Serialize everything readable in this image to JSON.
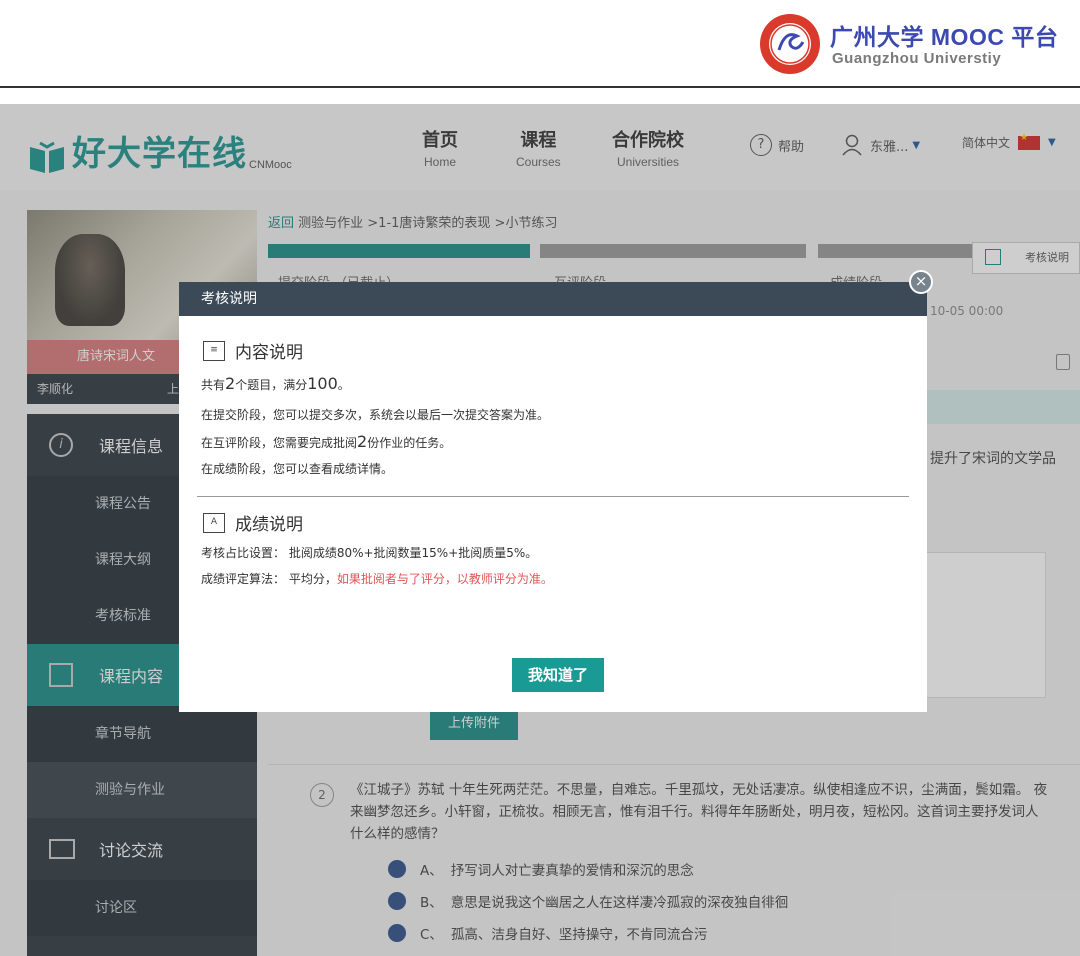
{
  "doc_header": {
    "logo_name": "广州大学 MOOC 平台",
    "logo_sub": "Guangzhou Universtiy"
  },
  "site": {
    "brand": "好大学在线",
    "brand_sub": "CNMooc",
    "nav": [
      {
        "zh": "首页",
        "en": "Home"
      },
      {
        "zh": "课程",
        "en": "Courses"
      },
      {
        "zh": "合作院校",
        "en": "Universities"
      }
    ],
    "help": "帮助",
    "user": "东雅...",
    "lang": "简体中文"
  },
  "sidebar": {
    "course_title": "唐诗宋词人文",
    "teacher": "李顺化",
    "teacher_extra": "上",
    "menu": [
      {
        "label": "课程信息",
        "type": "head"
      },
      {
        "label": "课程公告",
        "type": "sub"
      },
      {
        "label": "课程大纲",
        "type": "sub"
      },
      {
        "label": "考核标准",
        "type": "sub"
      },
      {
        "label": "课程内容",
        "type": "head"
      },
      {
        "label": "章节导航",
        "type": "sub"
      },
      {
        "label": "测验与作业",
        "type": "sub"
      },
      {
        "label": "讨论交流",
        "type": "head"
      },
      {
        "label": "讨论区",
        "type": "sub"
      }
    ]
  },
  "main": {
    "back": "返回",
    "breadcrumb": "测验与作业 >1-1唐诗繁荣的表现 >小节练习",
    "steps": [
      "提交阶段 （已截止）",
      "互评阶段",
      "成绩阶段"
    ],
    "exam_button": "考核说明",
    "date": "10-05 00:00",
    "right_text": "提升了宋词的文学品",
    "upload": "上传附件",
    "q2": {
      "num": "2",
      "stem": "《江城子》苏轼 十年生死两茫茫。不思量，自难忘。千里孤坟，无处话凄凉。纵使相逢应不识，尘满面，鬓如霜。 夜来幽梦忽还乡。小轩窗，正梳妆。相顾无言，惟有泪千行。料得年年肠断处，明月夜，短松冈。这首词主要抒发词人什么样的感情？",
      "options": [
        {
          "letter": "A、",
          "text": "抒写词人对亡妻真挚的爱情和深沉的思念"
        },
        {
          "letter": "B、",
          "text": "意思是说我这个幽居之人在这样凄冷孤寂的深夜独自徘徊"
        },
        {
          "letter": "C、",
          "text": "孤高、洁身自好、坚持操守，不肯同流合污"
        }
      ]
    }
  },
  "modal": {
    "title": "考核说明",
    "close": "×",
    "content_title": "内容说明",
    "content_lines": [
      {
        "pre": "共有",
        "big": "2",
        "mid": "个题目，满分",
        "big2": "100",
        "post": "。"
      },
      {
        "pre": "在提交阶段，您可以提交多次，系统会以最后一次提交答案为准。"
      },
      {
        "pre": "在互评阶段，您需要完成批阅",
        "big": "2",
        "mid": "份作业的任务。"
      },
      {
        "pre": "在成绩阶段，您可以查看成绩详情。"
      }
    ],
    "score_title": "成绩说明",
    "score_line1": "考核占比设置： 批阅成绩80%+批阅数量15%+批阅质量5%。",
    "score_line2_pre": "成绩评定算法： 平均分，",
    "score_line2_red": "如果批阅者与了评分，以教师评分为准。",
    "ok": "我知道了"
  }
}
